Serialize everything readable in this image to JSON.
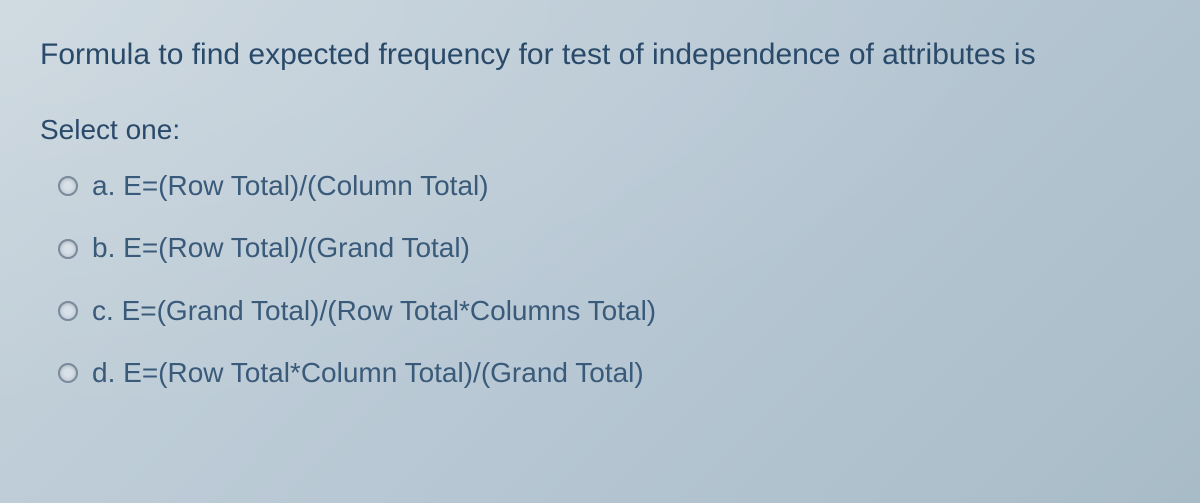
{
  "question": "Formula to find expected frequency for test of independence of attributes is",
  "select_label": "Select one:",
  "options": [
    {
      "letter": "a.",
      "text": "E=(Row Total)/(Column Total)"
    },
    {
      "letter": "b.",
      "text": "E=(Row Total)/(Grand Total)"
    },
    {
      "letter": "c.",
      "text": "E=(Grand Total)/(Row Total*Columns Total)"
    },
    {
      "letter": "d.",
      "text": "E=(Row Total*Column Total)/(Grand Total)"
    }
  ]
}
